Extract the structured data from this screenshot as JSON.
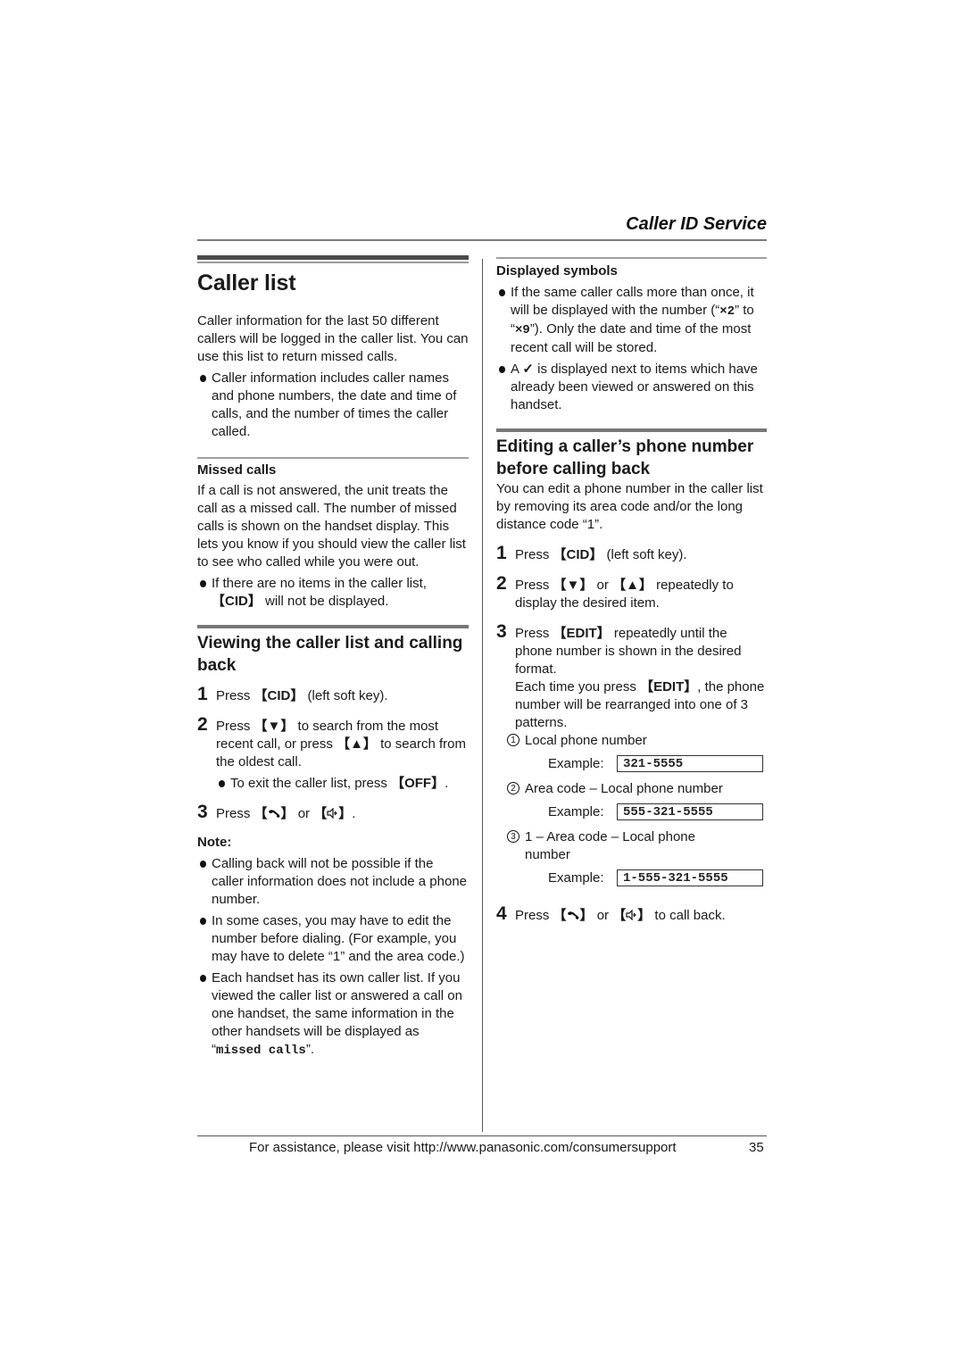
{
  "header": {
    "section_title": "Caller ID Service"
  },
  "left": {
    "page_title": "Caller list",
    "intro": "Caller information for the last 50 different callers will be logged in the caller list. You can use this list to return missed calls.",
    "intro_bullet": "Caller information includes caller names and phone numbers, the date and time of calls, and the number of times the caller called.",
    "missed": {
      "heading": "Missed calls",
      "body": "If a call is not answered, the unit treats the call as a missed call. The number of missed calls is shown on the handset display. This lets you know if you should view the caller list to see who called while you were out.",
      "bullet_key": "【CID】",
      "bullet_text": " will not be displayed.",
      "bullet_prefix": "If there are no items in the caller list, "
    },
    "viewing": {
      "heading": "Viewing the caller list and calling back",
      "steps": [
        {
          "num": "1",
          "pre": "Press ",
          "key": "【CID】",
          "post": " (left soft key)."
        },
        {
          "num": "2",
          "pre": "Press ",
          "key": "【▼】",
          "mid": " to search from the most recent call, or press ",
          "key2": "【▲】",
          "post": " to search from the oldest call."
        },
        {
          "num": "3",
          "pre": "Press ",
          "key_open": "【",
          "key_close": "】",
          "or": " or ",
          "end": "."
        }
      ],
      "step2_bullet_pre": "To exit the caller list, press ",
      "step2_bullet_key": "【OFF】",
      "step2_bullet_post": "."
    },
    "note": {
      "label": "Note:",
      "bullets": [
        "Calling back will not be possible if the caller information does not include a phone number.",
        "In some cases, you may have to edit the number before dialing. (For example, you may have to delete “1” and the area code.)"
      ],
      "bullet3_pre": "Each handset has its own caller list. If you viewed the caller list or answered a call on one handset, the same information in the other handsets will be displayed as “",
      "bullet3_mono": "missed calls",
      "bullet3_post": "”."
    }
  },
  "right": {
    "symbols": {
      "heading": "Displayed symbols",
      "b1_pre": "If the same caller calls more than once, it will be displayed with the number (“",
      "b1_x2": "×2",
      "b1_mid": "” to “",
      "b1_x9": "×9",
      "b1_post": "”). Only the date and time of the most recent call will be stored.",
      "b2_pre": "A ",
      "b2_check": "✓",
      "b2_post": " is displayed next to items which have already been viewed or answered on this handset."
    },
    "editing": {
      "heading": "Editing a caller’s phone number before calling back",
      "intro": "You can edit a phone number in the caller list by removing its area code and/or the long distance code “1”.",
      "step1": {
        "num": "1",
        "pre": "Press ",
        "key": "【CID】",
        "post": " (left soft key)."
      },
      "step2": {
        "num": "2",
        "pre": "Press ",
        "key": "【▼】",
        "mid": " or ",
        "key2": "【▲】",
        "post": " repeatedly to display the desired item."
      },
      "step3": {
        "num": "3",
        "pre": "Press ",
        "key": "【EDIT】",
        "post": " repeatedly until the phone number is shown in the desired format.",
        "line2_pre": "Each time you press ",
        "line2_key": "【EDIT】",
        "line2_post": ", the phone number will be rearranged into one of 3 patterns."
      },
      "patterns": [
        {
          "marker": "1",
          "label": "Local phone number",
          "example_label": "Example:",
          "example": "321-5555"
        },
        {
          "marker": "2",
          "label": "Area code – Local phone number",
          "example_label": "Example:",
          "example": "555-321-5555"
        },
        {
          "marker": "3",
          "label": "1 – Area code – Local phone number",
          "example_label": "Example:",
          "example": "1-555-321-5555"
        }
      ],
      "step4": {
        "num": "4",
        "pre": "Press ",
        "key_open": "【",
        "key_close": "】",
        "or": " or ",
        "post": " to call back."
      }
    }
  },
  "footer": {
    "text": "For assistance, please visit http://www.panasonic.com/consumersupport",
    "page_number": "35"
  }
}
